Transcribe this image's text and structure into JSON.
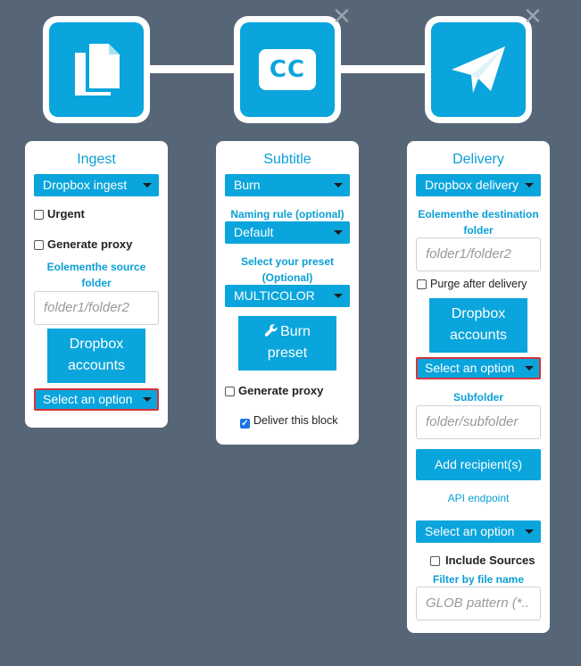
{
  "nodes": [
    {
      "name": "ingest",
      "icon": "document-copy-icon",
      "closable": false
    },
    {
      "name": "subtitle",
      "icon": "closed-caption-icon",
      "glyph": "CC",
      "closable": true
    },
    {
      "name": "delivery",
      "icon": "paper-plane-icon",
      "closable": true
    }
  ],
  "close_glyph": "✕",
  "ingest": {
    "title": "Ingest",
    "source_select": "Dropbox ingest",
    "urgent_label": "Urgent",
    "proxy_label": "Generate proxy",
    "folder_label": "Eolementhe source folder",
    "folder_placeholder": "folder1/folder2",
    "accounts_button": "Dropbox accounts",
    "account_select": "Select an option"
  },
  "subtitle": {
    "title": "Subtitle",
    "type_select": "Burn",
    "naming_label": "Naming rule (optional)",
    "naming_select": "Default",
    "preset_label": "Select your preset (Optional)",
    "preset_select": "MULTICOLOR",
    "burn_button": "Burn preset",
    "proxy_label": "Generate proxy",
    "deliver_label": "Deliver this block",
    "deliver_check": "✓"
  },
  "delivery": {
    "title": "Delivery",
    "dest_select": "Dropbox delivery",
    "folder_label": "Eolementhe destination folder",
    "folder_placeholder": "folder1/folder2",
    "purge_label": "Purge after delivery",
    "accounts_button": "Dropbox accounts",
    "account_select": "Select an option",
    "subfolder_label": "Subfolder",
    "subfolder_placeholder": "folder/subfolder",
    "recipient_button": "Add recipient(s)",
    "api_label": "API endpoint",
    "api_select": "Select an option",
    "sources_label": "Include Sources",
    "filter_label": "Filter by file name",
    "filter_placeholder": "GLOB pattern (*.."
  },
  "colors": {
    "accent": "#0aa5dc",
    "background": "#576677",
    "error_border": "#d8323c"
  }
}
